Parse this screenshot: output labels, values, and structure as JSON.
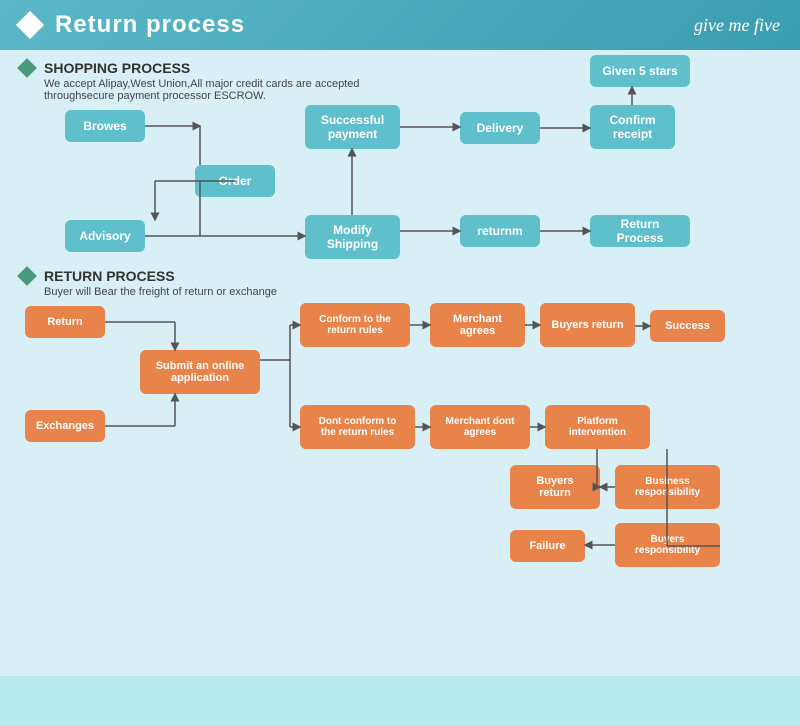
{
  "header": {
    "title": "Return process",
    "brand": "give me five"
  },
  "shopping": {
    "title": "SHOPPING PROCESS",
    "subtitle": "We accept Alipay,West Union,All major credit cards are accepted throughsecure payment processor ESCROW.",
    "nodes": [
      {
        "id": "browes",
        "label": "Browes"
      },
      {
        "id": "order",
        "label": "Order"
      },
      {
        "id": "advisory",
        "label": "Advisory"
      },
      {
        "id": "modify_shipping",
        "label": "Modify Shipping"
      },
      {
        "id": "successful_payment",
        "label": "Successful payment"
      },
      {
        "id": "delivery",
        "label": "Delivery"
      },
      {
        "id": "confirm_receipt",
        "label": "Confirm receipt"
      },
      {
        "id": "given_5_stars",
        "label": "Given 5 stars"
      },
      {
        "id": "returnm",
        "label": "returnm"
      },
      {
        "id": "return_process",
        "label": "Return Process"
      }
    ]
  },
  "return": {
    "title": "RETURN PROCESS",
    "subtitle": "Buyer will Bear the freight of return or exchange",
    "nodes": [
      {
        "id": "return",
        "label": "Return"
      },
      {
        "id": "exchanges",
        "label": "Exchanges"
      },
      {
        "id": "submit_online",
        "label": "Submit an online application"
      },
      {
        "id": "conform_rules",
        "label": "Conform to the return rules"
      },
      {
        "id": "dont_conform_rules",
        "label": "Dont conform to the return rules"
      },
      {
        "id": "merchant_agrees",
        "label": "Merchant agrees"
      },
      {
        "id": "merchant_dont_agrees",
        "label": "Merchant dont agrees"
      },
      {
        "id": "buyers_return1",
        "label": "Buyers return"
      },
      {
        "id": "platform_intervention",
        "label": "Platform intervention"
      },
      {
        "id": "success",
        "label": "Success"
      },
      {
        "id": "buyers_return2",
        "label": "Buyers return"
      },
      {
        "id": "business_responsibility",
        "label": "Business responsibility"
      },
      {
        "id": "failure",
        "label": "Failure"
      },
      {
        "id": "buyers_responsibility",
        "label": "Buyers responsibility"
      }
    ]
  }
}
